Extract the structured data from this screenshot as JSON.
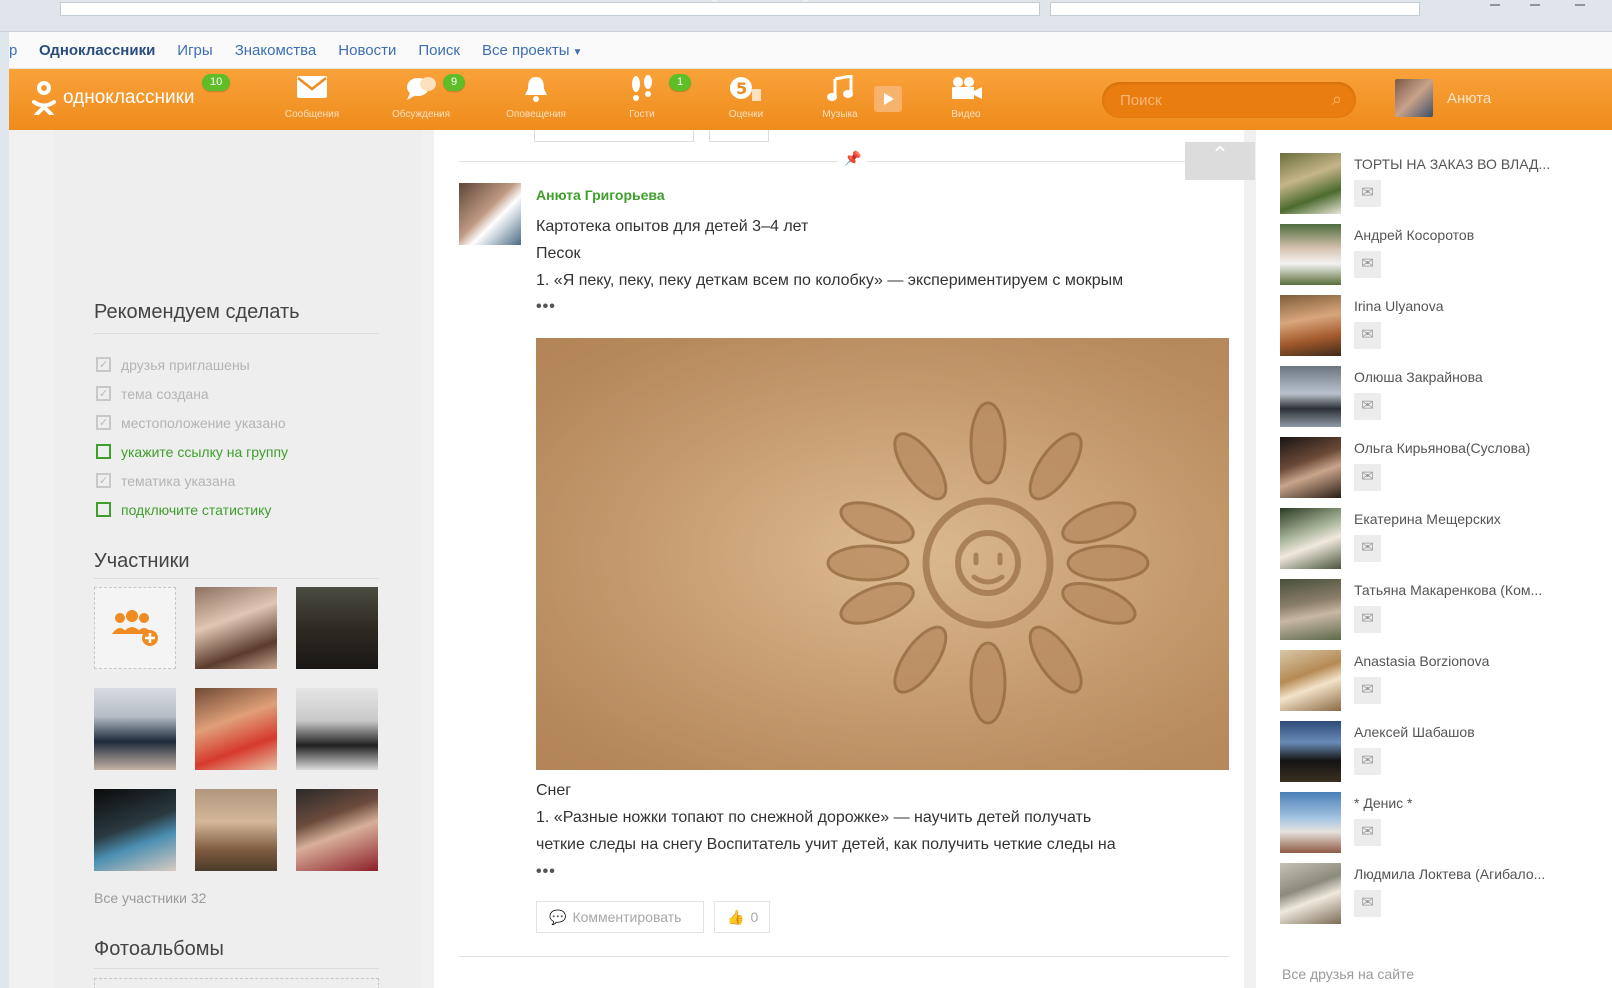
{
  "portal": {
    "first": "р",
    "links": [
      "Одноклассники",
      "Игры",
      "Знакомства",
      "Новости",
      "Поиск",
      "Все проекты"
    ]
  },
  "header": {
    "logo_text": "одноклассники",
    "logo_badge": "10",
    "nav": [
      {
        "label": "Сообщения",
        "icon": "envelope-icon",
        "badge": ""
      },
      {
        "label": "Обсуждения",
        "icon": "chat-icon",
        "badge": "9"
      },
      {
        "label": "Оповещения",
        "icon": "bell-icon",
        "badge": ""
      },
      {
        "label": "Гости",
        "icon": "footprints-icon",
        "badge": "1"
      },
      {
        "label": "Оценки",
        "icon": "rating-icon",
        "badge": ""
      },
      {
        "label": "Музыка",
        "icon": "music-icon",
        "badge": ""
      },
      {
        "label": "Видео",
        "icon": "video-icon",
        "badge": ""
      }
    ],
    "search_placeholder": "Поиск",
    "user_name": "Анюта"
  },
  "left": {
    "recommend_title": "Рекомендуем сделать",
    "tasks": [
      {
        "label": "друзья приглашены",
        "done": true
      },
      {
        "label": "тема создана",
        "done": true
      },
      {
        "label": "местоположение указано",
        "done": true
      },
      {
        "label": "укажите ссылку на группу",
        "done": false
      },
      {
        "label": "тематика указана",
        "done": true
      },
      {
        "label": "подключите статистику",
        "done": false
      }
    ],
    "members_title": "Участники",
    "all_members": "Все участники 32",
    "albums_title": "Фотоальбомы"
  },
  "post": {
    "author": "Анюта Григорьева",
    "title": "Картотека опытов для детей 3–4 лет",
    "section1": "Песок",
    "line1": "1. «Я пеку, пеку, пеку деткам всем по колобку» — экспериментируем с мокрым",
    "dots": "•••",
    "section2": "Снег",
    "line2": "1. «Разные ножки топают по снежной дорожке» — научить детей получать",
    "line3": "четкие следы на снегу Воспитатель учит детей, как получить четкие следы на",
    "comment_label": "Комментировать",
    "like_count": "0"
  },
  "friends": [
    {
      "name": "ТОРТЫ НА ЗАКАЗ ВО ВЛАД..."
    },
    {
      "name": "Андрей Косоротов"
    },
    {
      "name": "Irina Ulyanova"
    },
    {
      "name": "Олюша Закрайнова"
    },
    {
      "name": "Ольга Кирьянова(Суслова)"
    },
    {
      "name": "Екатерина Мещерских"
    },
    {
      "name": "Татьяна Макаренкова (Ком..."
    },
    {
      "name": "Anastasia Borzionova"
    },
    {
      "name": "Алексей Шабашов"
    },
    {
      "name": "* Денис *"
    },
    {
      "name": "Людмила Локтева (Агибало..."
    }
  ],
  "all_friends": "Все друзья на сайте",
  "colors": {
    "brand_orange": "#ef8b1c",
    "accent_green": "#3f9f2c",
    "link_blue": "#3d6fb5"
  }
}
